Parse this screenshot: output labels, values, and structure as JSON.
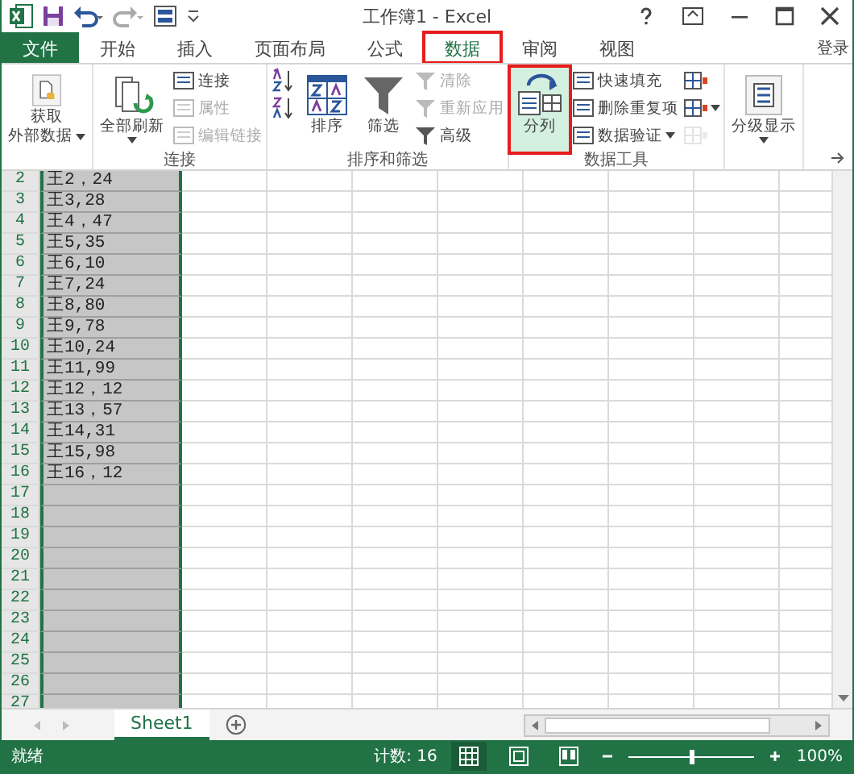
{
  "title_bar": {
    "title": "工作簿1 - Excel"
  },
  "tabs": [
    {
      "label": "文件",
      "kind": "file",
      "selected": false,
      "outlined": false
    },
    {
      "label": "开始",
      "kind": "tab",
      "selected": false,
      "outlined": false
    },
    {
      "label": "插入",
      "kind": "tab",
      "selected": false,
      "outlined": false
    },
    {
      "label": "页面布局",
      "kind": "tab",
      "selected": false,
      "outlined": false
    },
    {
      "label": "公式",
      "kind": "tab",
      "selected": false,
      "outlined": false
    },
    {
      "label": "数据",
      "kind": "tab",
      "selected": true,
      "outlined": true
    },
    {
      "label": "审阅",
      "kind": "tab",
      "selected": false,
      "outlined": false
    },
    {
      "label": "视图",
      "kind": "tab",
      "selected": false,
      "outlined": false
    }
  ],
  "account": "登录",
  "ribbon": {
    "groups": [
      {
        "columns": [
          [
            {
              "kind": "big",
              "lines": [
                "获取",
                "外部数据"
              ],
              "dropdown": true,
              "disabled": false,
              "highlighted": false,
              "outlined": false
            }
          ]
        ]
      },
      {
        "label": "连接",
        "columns": [
          [
            {
              "kind": "big",
              "lines": [
                "全部刷新"
              ],
              "dropdown": true,
              "disabled": false,
              "highlighted": false,
              "outlined": false
            }
          ],
          [
            {
              "kind": "small",
              "lines": [
                "连接"
              ],
              "dropdown": false,
              "disabled": false
            },
            {
              "kind": "small",
              "lines": [
                "属性"
              ],
              "dropdown": false,
              "disabled": true
            },
            {
              "kind": "small",
              "lines": [
                "编辑链接"
              ],
              "dropdown": false,
              "disabled": true
            }
          ]
        ]
      },
      {
        "label": "排序和筛选",
        "columns": [
          [
            {
              "kind": "icon",
              "dropdown": false,
              "disabled": false
            },
            {
              "kind": "icon",
              "dropdown": false,
              "disabled": false
            }
          ],
          [
            {
              "kind": "big",
              "lines": [
                "排序"
              ],
              "dropdown": false,
              "disabled": false,
              "highlighted": false,
              "outlined": false
            }
          ],
          [
            {
              "kind": "big",
              "lines": [
                "筛选"
              ],
              "dropdown": false,
              "disabled": false,
              "highlighted": false,
              "outlined": false
            }
          ],
          [
            {
              "kind": "small",
              "lines": [
                "清除"
              ],
              "dropdown": false,
              "disabled": true
            },
            {
              "kind": "small",
              "lines": [
                "重新应用"
              ],
              "dropdown": false,
              "disabled": true
            },
            {
              "kind": "small",
              "lines": [
                "高级"
              ],
              "dropdown": false,
              "disabled": false
            }
          ]
        ]
      },
      {
        "label": "数据工具",
        "columns": [
          [
            {
              "kind": "big",
              "lines": [
                "分列"
              ],
              "dropdown": false,
              "disabled": false,
              "highlighted": true,
              "outlined": true
            }
          ],
          [
            {
              "kind": "small",
              "lines": [
                "快速填充"
              ],
              "dropdown": false,
              "disabled": false
            },
            {
              "kind": "small",
              "lines": [
                "删除重复项"
              ],
              "dropdown": false,
              "disabled": false
            },
            {
              "kind": "small",
              "lines": [
                "数据验证"
              ],
              "dropdown": true,
              "disabled": false
            }
          ],
          [
            {
              "kind": "icon",
              "dropdown": false,
              "disabled": false
            },
            {
              "kind": "icon",
              "dropdown": true,
              "disabled": false
            },
            {
              "kind": "icon",
              "dropdown": false,
              "disabled": true
            }
          ]
        ]
      },
      {
        "columns": [
          [
            {
              "kind": "big",
              "lines": [
                "分级显示"
              ],
              "dropdown": true,
              "disabled": false,
              "highlighted": false,
              "outlined": false
            }
          ]
        ]
      }
    ]
  },
  "grid": {
    "column_a_selected": true,
    "rows": [
      {
        "number": "2",
        "cell": "王2，24"
      },
      {
        "number": "3",
        "cell": "王3,28"
      },
      {
        "number": "4",
        "cell": "王4，47"
      },
      {
        "number": "5",
        "cell": "王5,35"
      },
      {
        "number": "6",
        "cell": "王6,10"
      },
      {
        "number": "7",
        "cell": "王7,24"
      },
      {
        "number": "8",
        "cell": "王8,80"
      },
      {
        "number": "9",
        "cell": "王9,78"
      },
      {
        "number": "10",
        "cell": "王10,24"
      },
      {
        "number": "11",
        "cell": "王11,99"
      },
      {
        "number": "12",
        "cell": "王12，12"
      },
      {
        "number": "13",
        "cell": "王13，57"
      },
      {
        "number": "14",
        "cell": "王14,31"
      },
      {
        "number": "15",
        "cell": "王15,98"
      },
      {
        "number": "16",
        "cell": "王16，12"
      },
      {
        "number": "17"
      },
      {
        "number": "18"
      },
      {
        "number": "19"
      },
      {
        "number": "20"
      },
      {
        "number": "21"
      },
      {
        "number": "22"
      },
      {
        "number": "23"
      },
      {
        "number": "24"
      },
      {
        "number": "25"
      },
      {
        "number": "26"
      },
      {
        "number": "27"
      }
    ]
  },
  "sheet_tabs": [
    {
      "label": "Sheet1",
      "selected": true
    }
  ],
  "status_bar": {
    "status": "就绪",
    "count": "计数: 16",
    "views": [
      {
        "kind": "normal",
        "selected": true
      },
      {
        "kind": "layout",
        "selected": false
      },
      {
        "kind": "pagebreak",
        "selected": false
      }
    ],
    "zoom": {
      "level": 0.5,
      "reading": "100%"
    }
  }
}
